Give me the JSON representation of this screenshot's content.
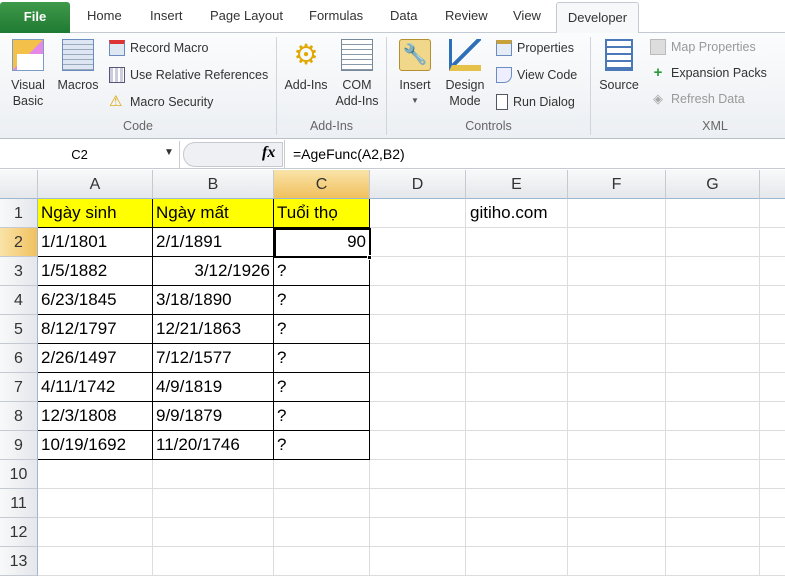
{
  "tabs": {
    "file": "File",
    "items": [
      "Home",
      "Insert",
      "Page Layout",
      "Formulas",
      "Data",
      "Review",
      "View"
    ],
    "active": "Developer"
  },
  "ribbon": {
    "code": {
      "label": "Code",
      "visual_basic": [
        "Visual",
        "Basic"
      ],
      "macros": "Macros",
      "record_macro": "Record Macro",
      "use_relative": "Use Relative References",
      "macro_security": "Macro Security"
    },
    "addins": {
      "label": "Add-Ins",
      "addins": "Add-Ins",
      "com": [
        "COM",
        "Add-Ins"
      ]
    },
    "controls": {
      "label": "Controls",
      "insert": "Insert",
      "design": [
        "Design",
        "Mode"
      ],
      "properties": "Properties",
      "view_code": "View Code",
      "run_dialog": "Run Dialog"
    },
    "xml": {
      "label": "XML",
      "source": "Source",
      "map_properties": "Map Properties",
      "expansion_packs": "Expansion Packs",
      "refresh_data": "Refresh Data"
    }
  },
  "formula_bar": {
    "name_box": "C2",
    "fx": "fx",
    "formula": "=AgeFunc(A2,B2)"
  },
  "columns": [
    "A",
    "B",
    "C",
    "D",
    "E",
    "F",
    "G"
  ],
  "rows": [
    "1",
    "2",
    "3",
    "4",
    "5",
    "6",
    "7",
    "8",
    "9",
    "10",
    "11",
    "12",
    "13"
  ],
  "headers": {
    "a": "Ngày sinh",
    "b": "Ngày mất",
    "c": "Tuổi thọ",
    "e": "gitiho.com"
  },
  "data": [
    {
      "a": "1/1/1801",
      "b": "2/1/1891",
      "c": "90"
    },
    {
      "a": "1/5/1882",
      "b": "3/12/1926",
      "c": "?"
    },
    {
      "a": "6/23/1845",
      "b": "3/18/1890",
      "c": "?"
    },
    {
      "a": "8/12/1797",
      "b": "12/21/1863",
      "c": "?"
    },
    {
      "a": "2/26/1497",
      "b": "7/12/1577",
      "c": "?"
    },
    {
      "a": "4/11/1742",
      "b": "4/9/1819",
      "c": "?"
    },
    {
      "a": "12/3/1808",
      "b": "9/9/1879",
      "c": "?"
    },
    {
      "a": "10/19/1692",
      "b": "11/20/1746",
      "c": "?"
    }
  ]
}
